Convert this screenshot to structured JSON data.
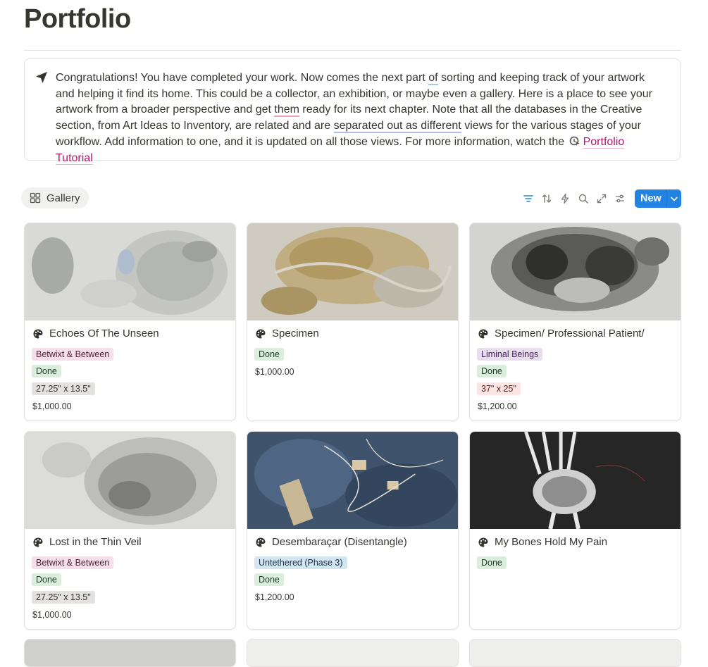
{
  "page": {
    "title": "Portfolio"
  },
  "callout": {
    "icon": "navigation-arrow-icon",
    "segments": [
      "Congratulations! You have completed your work. Now comes the next part ",
      "of",
      " sorting and keeping track of your artwork and helping it find its home. This could be a collector, an exhibition, or maybe even a gallery. Here is a place to see your artwork from a broader perspective and get ",
      "them",
      " ready for its next chapter. Note that all the databases in the Creative section, from Art Ideas to Inventory, are related and are ",
      "separated out as different",
      " views for the various stages of your workflow. Add information to one, and it is updated on all those views. For more information, watch the "
    ],
    "link_label": "Portfolio Tutorial"
  },
  "view": {
    "tab_label": "Gallery",
    "tab_icon": "gallery-grid-icon"
  },
  "toolbar": {
    "icons": [
      "filter-icon",
      "sort-icon",
      "automation-bolt-icon",
      "search-icon",
      "expand-icon",
      "settings-sliders-icon"
    ],
    "new_label": "New"
  },
  "colors": {
    "accent": "#2383e2",
    "link": "#ad1a72"
  },
  "cards": [
    {
      "title": "Echoes Of The Unseen",
      "tags": [
        {
          "label": "Betwixt & Between",
          "color": "pink"
        },
        {
          "label": "Done",
          "color": "green"
        },
        {
          "label": "27.25\" x 13.5\"",
          "color": "gray"
        }
      ],
      "price": "$1,000.00"
    },
    {
      "title": "Specimen",
      "tags": [
        {
          "label": "Done",
          "color": "green"
        }
      ],
      "price": "$1,000.00"
    },
    {
      "title": "Specimen/ Professional Patient/",
      "tags": [
        {
          "label": "Liminal Beings",
          "color": "purple"
        },
        {
          "label": "Done",
          "color": "green"
        },
        {
          "label": "37\" x 25\"",
          "color": "rose"
        }
      ],
      "price": "$1,200.00"
    },
    {
      "title": "Lost in the Thin Veil",
      "tags": [
        {
          "label": "Betwixt & Between",
          "color": "pink"
        },
        {
          "label": "Done",
          "color": "green"
        },
        {
          "label": "27.25\" x 13.5\"",
          "color": "gray"
        }
      ],
      "price": "$1,000.00"
    },
    {
      "title": "Desembaraçar (Disentangle)",
      "tags": [
        {
          "label": "Untethered (Phase 3)",
          "color": "blue"
        },
        {
          "label": "Done",
          "color": "green"
        }
      ],
      "price": "$1,200.00"
    },
    {
      "title": "My Bones Hold My Pain",
      "tags": [
        {
          "label": "Done",
          "color": "green"
        }
      ],
      "price": ""
    }
  ]
}
